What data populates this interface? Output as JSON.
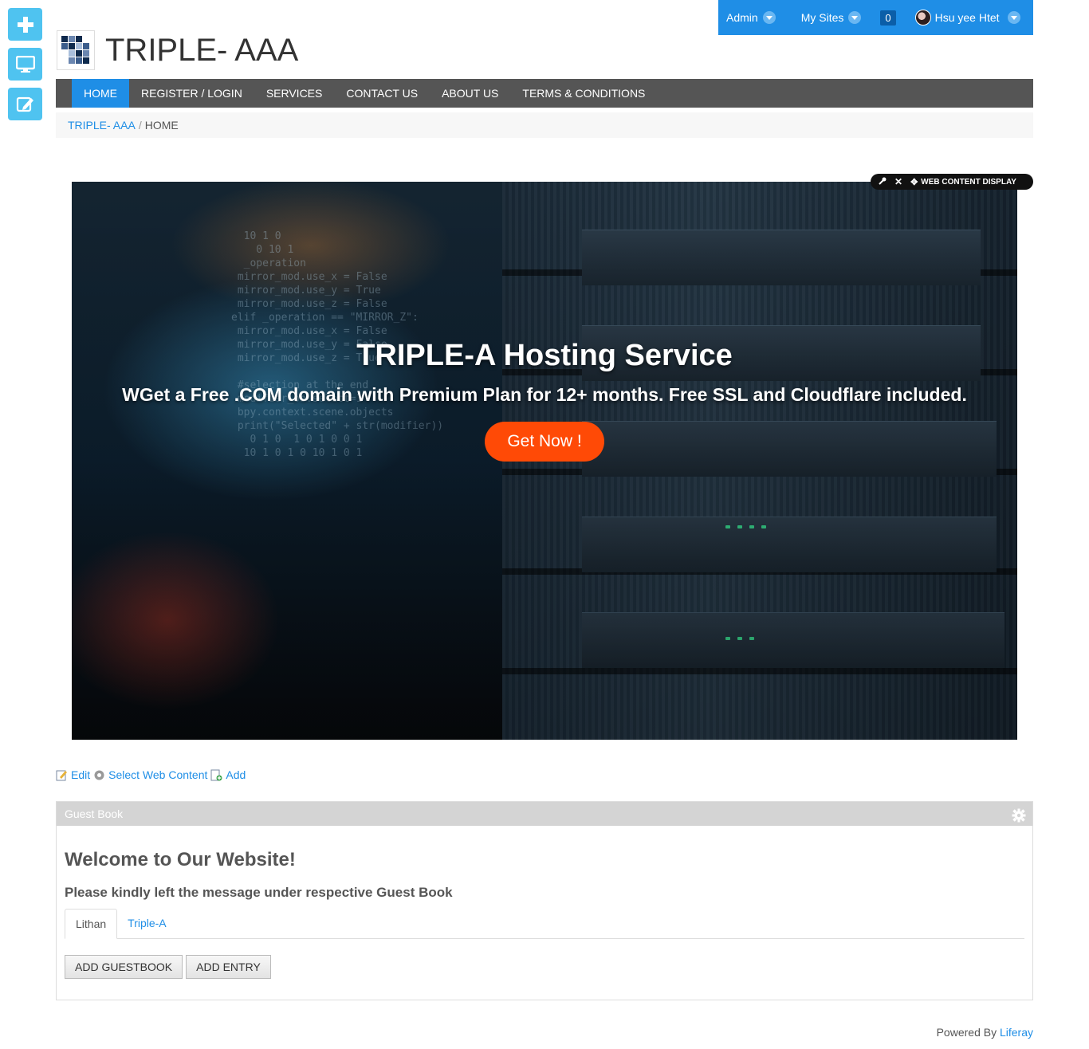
{
  "dock": {
    "items": [
      "add-icon",
      "preview-icon",
      "edit-icon"
    ]
  },
  "userbar": {
    "admin_label": "Admin",
    "mysites_label": "My Sites",
    "notification_count": "0",
    "user_name": "Hsu yee Htet"
  },
  "site": {
    "title": "TRIPLE- AAA"
  },
  "nav": {
    "items": [
      {
        "label": "HOME"
      },
      {
        "label": "REGISTER / LOGIN"
      },
      {
        "label": "SERVICES"
      },
      {
        "label": "CONTACT US"
      },
      {
        "label": "ABOUT US"
      },
      {
        "label": "TERMS & CONDITIONS"
      }
    ]
  },
  "breadcrumb": {
    "site": "TRIPLE- AAA",
    "separator": "/",
    "current": "HOME"
  },
  "portlet_topper": {
    "title": "WEB CONTENT DISPLAY"
  },
  "hero": {
    "title": "TRIPLE-A Hosting Service",
    "subtitle": "WGet a Free .COM domain with Premium Plan for 12+ months. Free SSL and Cloudflare included.",
    "cta": "Get Now !"
  },
  "edit_bar": {
    "edit": "Edit",
    "select": "Select Web Content",
    "add": "Add"
  },
  "guestbook": {
    "portlet_title": "Guest Book",
    "heading": "Welcome to Our Website!",
    "subheading": "Please kindly left the message under respective Guest Book",
    "tabs": [
      {
        "label": "Lithan"
      },
      {
        "label": "Triple-A"
      }
    ],
    "add_guestbook": "ADD GUESTBOOK",
    "add_entry": "ADD ENTRY"
  },
  "footer": {
    "prefix": "Powered By",
    "link": "Liferay"
  },
  "colors": {
    "accent": "#1f8ee6",
    "cta": "#ff4a06",
    "nav_bg": "#555555",
    "dock": "#4fc3f0"
  }
}
